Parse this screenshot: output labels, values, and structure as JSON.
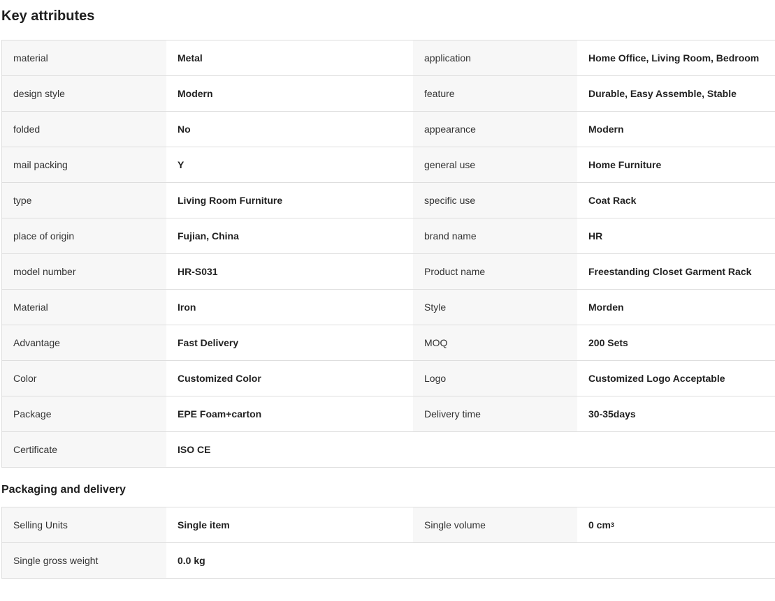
{
  "key_attributes": {
    "title": "Key attributes",
    "rows": [
      {
        "l1": "material",
        "v1": "Metal",
        "l2": "application",
        "v2": "Home Office, Living Room, Bedroom"
      },
      {
        "l1": "design style",
        "v1": "Modern",
        "l2": "feature",
        "v2": "Durable, Easy Assemble, Stable"
      },
      {
        "l1": "folded",
        "v1": "No",
        "l2": "appearance",
        "v2": "Modern"
      },
      {
        "l1": "mail packing",
        "v1": "Y",
        "l2": "general use",
        "v2": "Home Furniture"
      },
      {
        "l1": "type",
        "v1": "Living Room Furniture",
        "l2": "specific use",
        "v2": "Coat Rack"
      },
      {
        "l1": "place of origin",
        "v1": "Fujian, China",
        "l2": "brand name",
        "v2": "HR"
      },
      {
        "l1": "model number",
        "v1": "HR-S031",
        "l2": "Product name",
        "v2": "Freestanding Closet Garment Rack"
      },
      {
        "l1": "Material",
        "v1": "Iron",
        "l2": "Style",
        "v2": "Morden"
      },
      {
        "l1": "Advantage",
        "v1": "Fast Delivery",
        "l2": "MOQ",
        "v2": "200 Sets"
      },
      {
        "l1": "Color",
        "v1": "Customized Color",
        "l2": "Logo",
        "v2": "Customized Logo Acceptable"
      },
      {
        "l1": "Package",
        "v1": "EPE Foam+carton",
        "l2": "Delivery time",
        "v2": "30-35days"
      },
      {
        "l1": "Certificate",
        "v1": "ISO CE",
        "l2": "",
        "v2": ""
      }
    ]
  },
  "packaging": {
    "title": "Packaging and delivery",
    "rows": [
      {
        "l1": "Selling Units",
        "v1": "Single item",
        "l2": "Single volume",
        "v2": "0 cm",
        "v2_sup": "3"
      },
      {
        "l1": "Single gross weight",
        "v1": "0.0 kg",
        "l2": "",
        "v2": ""
      }
    ]
  }
}
